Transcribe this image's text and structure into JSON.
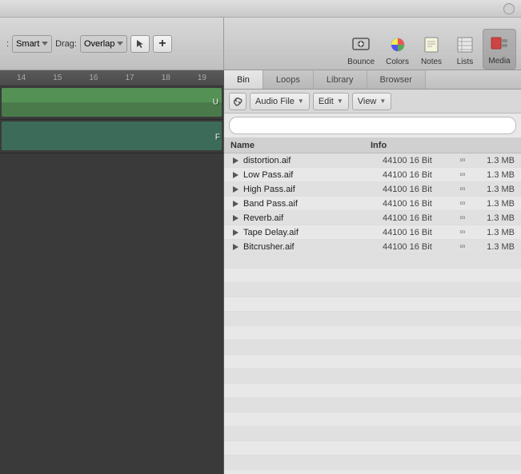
{
  "titleBar": {
    "button": "close"
  },
  "toolbar": {
    "leftLabel1": "Smart",
    "leftLabel2": "Drag:",
    "leftLabel3": "Overlap",
    "icons": [
      {
        "id": "bounce",
        "label": "Bounce",
        "shape": "bounce"
      },
      {
        "id": "colors",
        "label": "Colors",
        "shape": "colors"
      },
      {
        "id": "notes",
        "label": "Notes",
        "shape": "notes"
      },
      {
        "id": "lists",
        "label": "Lists",
        "shape": "lists"
      },
      {
        "id": "media",
        "label": "Media",
        "shape": "media",
        "active": true
      }
    ]
  },
  "tabs": [
    {
      "id": "bin",
      "label": "Bin",
      "active": true
    },
    {
      "id": "loops",
      "label": "Loops",
      "active": false
    },
    {
      "id": "library",
      "label": "Library",
      "active": false
    },
    {
      "id": "browser",
      "label": "Browser",
      "active": false
    }
  ],
  "browserToolbar": {
    "linkLabel": "🔗",
    "audioFile": "Audio File",
    "edit": "Edit",
    "view": "View"
  },
  "fileList": {
    "headers": {
      "name": "Name",
      "info": "Info"
    },
    "files": [
      {
        "name": "distortion.aif",
        "info": "44100 16 Bit",
        "link": "∞",
        "size": "1.3 MB"
      },
      {
        "name": "Low Pass.aif",
        "info": "44100 16 Bit",
        "link": "∞",
        "size": "1.3 MB"
      },
      {
        "name": "High Pass.aif",
        "info": "44100 16 Bit",
        "link": "∞",
        "size": "1.3 MB"
      },
      {
        "name": "Band Pass.aif",
        "info": "44100 16 Bit",
        "link": "∞",
        "size": "1.3 MB"
      },
      {
        "name": "Reverb.aif",
        "info": "44100 16 Bit",
        "link": "∞",
        "size": "1.3 MB"
      },
      {
        "name": "Tape Delay.aif",
        "info": "44100 16 Bit",
        "link": "∞",
        "size": "1.3 MB"
      },
      {
        "name": "Bitcrusher.aif",
        "info": "44100 16 Bit",
        "link": "∞",
        "size": "1.3 MB"
      }
    ]
  },
  "ruler": {
    "marks": [
      "14",
      "15",
      "16",
      "17",
      "18",
      "19"
    ]
  },
  "tracks": [
    {
      "id": "track1",
      "color": "green",
      "label": "U"
    },
    {
      "id": "track2",
      "color": "teal",
      "label": "F"
    }
  ]
}
